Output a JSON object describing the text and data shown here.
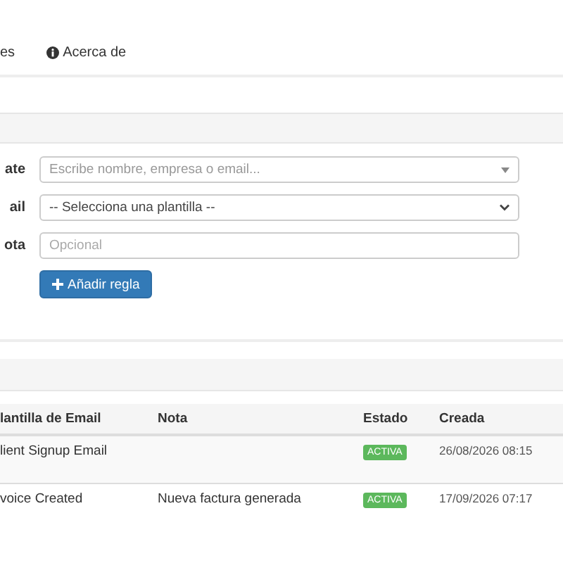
{
  "nav": [
    {
      "label": "es",
      "kind": "plain"
    },
    {
      "label": "Acerca de",
      "kind": "info"
    }
  ],
  "form": {
    "fields": [
      {
        "label": "ate",
        "kind": "combo",
        "placeholder": "Escribe nombre, empresa o email..."
      },
      {
        "label": "ail",
        "kind": "select",
        "value": "-- Selecciona una plantilla --"
      },
      {
        "label": "ota",
        "kind": "text",
        "placeholder": "Opcional"
      }
    ],
    "button": "Añadir regla"
  },
  "table": {
    "columns": [
      "lantilla de Email",
      "Nota",
      "Estado",
      "Creada"
    ],
    "rows": [
      {
        "template": "lient Signup Email",
        "status": "ACTIVA",
        "created": "26/08/2026 08:15"
      },
      {
        "template": "voice Created",
        "note": "Nueva factura generada",
        "status": "ACTIVA",
        "created": "17/09/2026 07:17"
      }
    ]
  }
}
